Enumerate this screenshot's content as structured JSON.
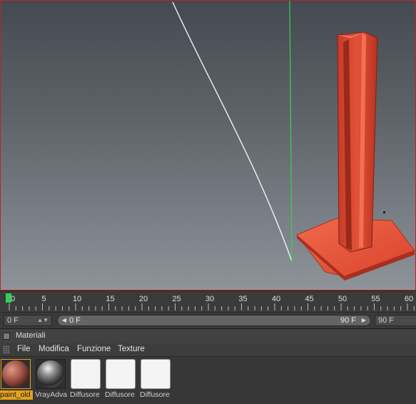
{
  "timeline": {
    "ticks": [
      "0",
      "5",
      "10",
      "15",
      "20",
      "25",
      "30",
      "35",
      "40",
      "45",
      "50",
      "55",
      "60"
    ],
    "current_frame": 0
  },
  "range_bar": {
    "start_field": "0 F",
    "slider_start": "0 F",
    "slider_end": "90 F",
    "end_field": "90 F"
  },
  "materials": {
    "panel_title": "Materiali",
    "menu": [
      "File",
      "Modifica",
      "Funzione",
      "Texture"
    ],
    "items": [
      {
        "label": "paint_old",
        "selected": true
      },
      {
        "label": "VrayAdva",
        "selected": false
      },
      {
        "label": "Diffusore",
        "selected": false
      },
      {
        "label": "Diffusore",
        "selected": false
      },
      {
        "label": "Diffusore",
        "selected": false
      }
    ]
  },
  "colors": {
    "viewport_border": "#c81e1e",
    "object_red": "#e0533a",
    "selection_orange": "#e2a21f",
    "playhead_green": "#2fd15a"
  }
}
